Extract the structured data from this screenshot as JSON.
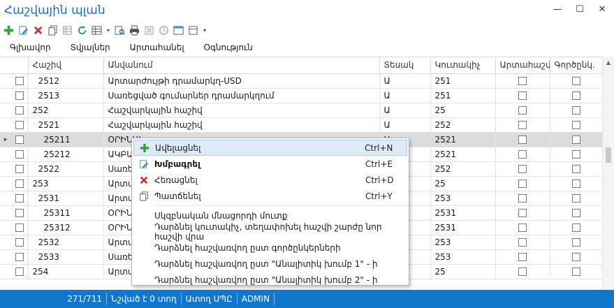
{
  "window": {
    "title": "Հաշվային պլան"
  },
  "toolbar": {
    "icons": [
      "add-icon",
      "edit-icon",
      "delete-icon",
      "copy-icon",
      "copy-grid-icon",
      "refresh-icon",
      "table-view-icon",
      "preview-icon",
      "print-icon",
      "export-icon",
      "history-icon",
      "layout-icon",
      "filter-icon",
      "dropdown-arrow-icon"
    ]
  },
  "menu": {
    "items": [
      "Գլխավոր",
      "Տվյալներ",
      "Արտահանել",
      "Օգնություն"
    ]
  },
  "grid": {
    "columns": [
      "Հաշիվ",
      "Անվանում",
      "Տեսակ",
      "Կուտակիչ",
      "Արտահաշվ.",
      "Գործընկ."
    ],
    "rows": [
      {
        "code": "2512",
        "name": "Արտարժույթի դրամարկղ-USD",
        "type": "Ա",
        "acc": "251"
      },
      {
        "code": "2513",
        "name": "Սառեցված գումարներ դրամարկղում",
        "type": "Ա",
        "acc": "251"
      },
      {
        "code": "252",
        "name": "Հաշվարկային հաշիվ",
        "type": "Ա",
        "acc": "25"
      },
      {
        "code": "2521",
        "name": "Հաշվարկային հաշիվ",
        "type": "Ա",
        "acc": "252"
      },
      {
        "code": "25211",
        "name": "ՕՐԻՆԱԿ ...",
        "type": "Ա",
        "acc": "2521",
        "selected": true
      },
      {
        "code": "25212",
        "name": "ԱԿԲԱ ...",
        "type": "",
        "acc": "2521"
      },
      {
        "code": "2522",
        "name": "Սառեց...",
        "type": "",
        "acc": "252"
      },
      {
        "code": "253",
        "name": "Արտար...",
        "type": "",
        "acc": "25"
      },
      {
        "code": "2531",
        "name": "Արտար...",
        "type": "",
        "acc": "253"
      },
      {
        "code": "25311",
        "name": "ՕՐԻՆԱ...",
        "type": "",
        "acc": "2531"
      },
      {
        "code": "25312",
        "name": "ՕՐԻՆԱ...",
        "type": "",
        "acc": "2531"
      },
      {
        "code": "2532",
        "name": "Արտար...",
        "type": "",
        "acc": "253"
      },
      {
        "code": "2533",
        "name": "Սառեց...",
        "type": "",
        "acc": "253"
      },
      {
        "code": "254",
        "name": "Արտար...",
        "type": "",
        "acc": "25"
      }
    ]
  },
  "context_menu": {
    "items": [
      {
        "label": "Ավելացնել",
        "shortcut": "Ctrl+N",
        "icon": "add-icon"
      },
      {
        "label": "Խմբագրել",
        "shortcut": "Ctrl+E",
        "icon": "edit-icon"
      },
      {
        "label": "Հեռացնել",
        "shortcut": "Ctrl+D",
        "icon": "delete-icon"
      },
      {
        "label": "Պատճենել",
        "shortcut": "Ctrl+Y",
        "icon": "copy-icon"
      }
    ],
    "extra_items": [
      "Սկզբնական մնացորդի մուտք",
      "Դարձնել կուտակիչ, տեղափոխել հաշվի շարժը նոր հաշվի վրա",
      "Դարձնել հաշվառվող ըստ գործընկերների",
      "Դարձնել հաշվառվող ըստ \"Անալիտիկ խումբ 1\" - ի",
      "Դարձնել հաշվառվող ըստ \"Անալիտիկ խումբ 2\" - ի"
    ]
  },
  "status": {
    "count": "271/711",
    "selected": "Նշված է 0 տող",
    "user": "Ատող ՍՊԸ",
    "role": "ADMIN"
  },
  "colors": {
    "accent": "#1177cc",
    "title": "#1f6fc5",
    "selected_row": "#dcdcdc",
    "menu_highlight": "#dceaf9"
  }
}
